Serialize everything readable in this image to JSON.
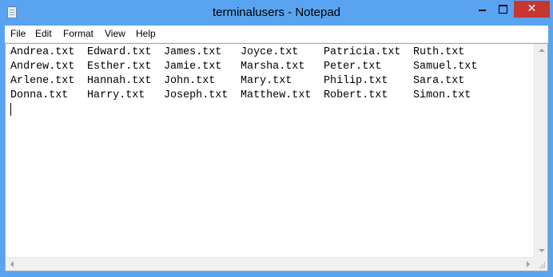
{
  "window": {
    "title": "terminalusers - Notepad",
    "close_glyph": "✕",
    "accent_color": "#5aa3f0",
    "close_color": "#c7372f"
  },
  "menu": [
    "File",
    "Edit",
    "Format",
    "View",
    "Help"
  ],
  "document": {
    "rows": [
      [
        "Andrea.txt",
        "Edward.txt",
        "James.txt",
        "Joyce.txt",
        "Patricia.txt",
        "Ruth.txt"
      ],
      [
        "Andrew.txt",
        "Esther.txt",
        "Jamie.txt",
        "Marsha.txt",
        "Peter.txt",
        "Samuel.txt"
      ],
      [
        "Arlene.txt",
        "Hannah.txt",
        "John.txt",
        "Mary.txt",
        "Philip.txt",
        "Sara.txt"
      ],
      [
        "Donna.txt",
        "Harry.txt",
        "Joseph.txt",
        "Matthew.txt",
        "Robert.txt",
        "Simon.txt"
      ]
    ]
  },
  "icons": {
    "app": "notepad-icon",
    "minimize": "minimize-icon",
    "maximize": "maximize-icon",
    "close": "close-icon"
  }
}
